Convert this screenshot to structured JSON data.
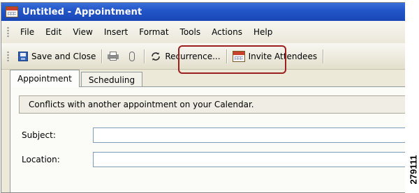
{
  "window": {
    "title": "Untitled - Appointment"
  },
  "menu": [
    {
      "label": "File"
    },
    {
      "label": "Edit"
    },
    {
      "label": "View"
    },
    {
      "label": "Insert"
    },
    {
      "label": "Format"
    },
    {
      "label": "Tools"
    },
    {
      "label": "Actions"
    },
    {
      "label": "Help"
    }
  ],
  "toolbar": {
    "save_close": "Save and Close",
    "recurrence": "Recurrence...",
    "invite": "Invite Attendees"
  },
  "tabs": [
    {
      "label": "Appointment",
      "active": true
    },
    {
      "label": "Scheduling",
      "active": false
    }
  ],
  "info_message": "Conflicts with another appointment on your Calendar.",
  "form": {
    "subject_label": "Subject:",
    "subject_value": "",
    "location_label": "Location:",
    "location_value": ""
  },
  "figure_id": "279111",
  "colors": {
    "title_bar": "#2356c9",
    "highlight": "#9b1f1f"
  }
}
